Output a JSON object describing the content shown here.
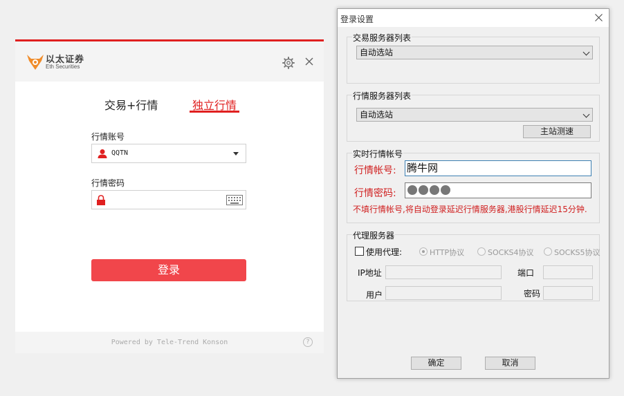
{
  "login_window": {
    "brand_name": "以太证券",
    "brand_sub": "Eth Securities",
    "tabs": [
      {
        "label": "交易+行情",
        "active": false
      },
      {
        "label": "独立行情",
        "active": true
      }
    ],
    "account_label": "行情账号",
    "account_value": "QQTN",
    "password_label": "行情密码",
    "password_value": "",
    "login_button": "登录",
    "footer_text": "Powered by Tele-Trend Konson",
    "help_glyph": "?",
    "accent_color": "#e02020",
    "button_color": "#f1464b"
  },
  "settings_dialog": {
    "title": "登录设置",
    "trade_servers": {
      "title": "交易服务器列表",
      "selected": "自动选站"
    },
    "quote_servers": {
      "title": "行情服务器列表",
      "selected": "自动选站",
      "test_button": "主站测速"
    },
    "realtime_account": {
      "title": "实时行情帐号",
      "account_label": "行情帐号:",
      "account_value": "腾牛网",
      "password_label": "行情密码:",
      "password_mask_count": 4,
      "note": "不填行情帐号,将自动登录延迟行情服务器,港股行情延迟15分钟."
    },
    "proxy": {
      "title": "代理服务器",
      "use_proxy_label": "使用代理:",
      "use_proxy_checked": false,
      "protocols": [
        {
          "label": "HTTP协议",
          "selected": true
        },
        {
          "label": "SOCKS4协议",
          "selected": false
        },
        {
          "label": "SOCKS5协议",
          "selected": false
        }
      ],
      "ip_label": "IP地址",
      "ip_value": "",
      "port_label": "端口",
      "port_value": "",
      "user_label": "用户",
      "user_value": "",
      "password_label": "密码",
      "password_value": ""
    },
    "ok_button": "确定",
    "cancel_button": "取消",
    "note_color": "#d02020"
  }
}
